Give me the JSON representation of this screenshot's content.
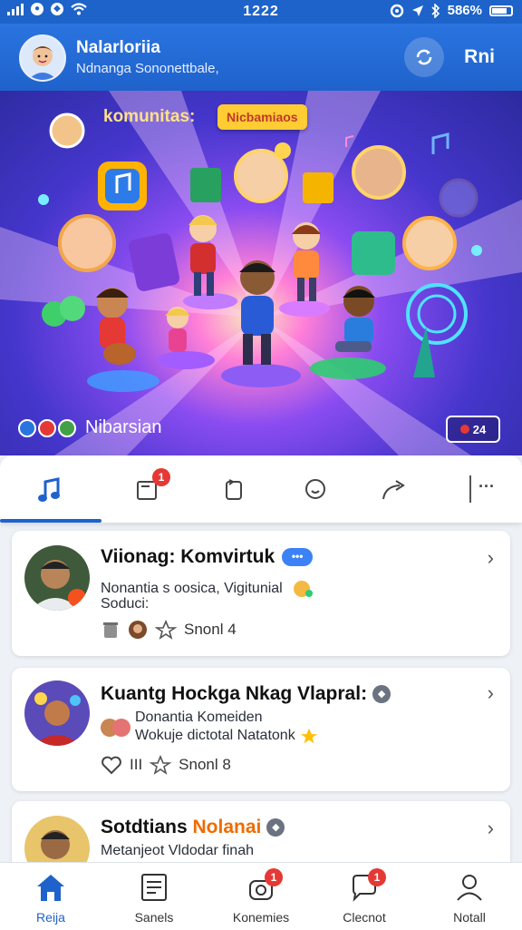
{
  "status_bar": {
    "time": "1222",
    "battery": "586%"
  },
  "header": {
    "title": "Nalarloriia",
    "subtitle": "Ndnanga Sononettbale,",
    "action_label": "Rni"
  },
  "hero": {
    "keyword": "komunitas:",
    "chip": "Nicbamiaos",
    "caption": "Nibarsian",
    "badge_count": "24"
  },
  "tabs": [
    {
      "icon": "music-note-icon",
      "badge": null
    },
    {
      "icon": "notification-card-icon",
      "badge": "1"
    },
    {
      "icon": "refresh-card-icon",
      "badge": null
    },
    {
      "icon": "chat-bubble-icon",
      "badge": null
    },
    {
      "icon": "share-icon",
      "badge": null
    }
  ],
  "feed": [
    {
      "title": "Viionag: Komvirtuk",
      "line1": "Nonantia s oosica, Vigitunial",
      "line2": "Soduci:",
      "meta": "Snonl 4"
    },
    {
      "title": "Kuantg Hockga Nkag Vlapral:",
      "line1": "Donantia Komeiden",
      "line2": "Wokuje dictotal Natatonk",
      "meta_left": "III",
      "meta": "Snonl 8"
    },
    {
      "title_a": "Sotdtians",
      "title_b": "Nolanai",
      "line1": "Metanjeot Vldodar finah"
    }
  ],
  "bottom_nav": [
    {
      "label": "Reija",
      "icon": "home-icon",
      "badge": null
    },
    {
      "label": "Sanels",
      "icon": "list-doc-icon",
      "badge": null
    },
    {
      "label": "Konemies",
      "icon": "community-icon",
      "badge": "1"
    },
    {
      "label": "Clecnot",
      "icon": "chat-icon",
      "badge": "1"
    },
    {
      "label": "Notall",
      "icon": "profile-icon",
      "badge": null
    }
  ],
  "colors": {
    "brand_blue": "#1f62cc",
    "badge_red": "#e53935",
    "chip_yellow": "#ffcc33",
    "accent_orange": "#ef6c00"
  }
}
